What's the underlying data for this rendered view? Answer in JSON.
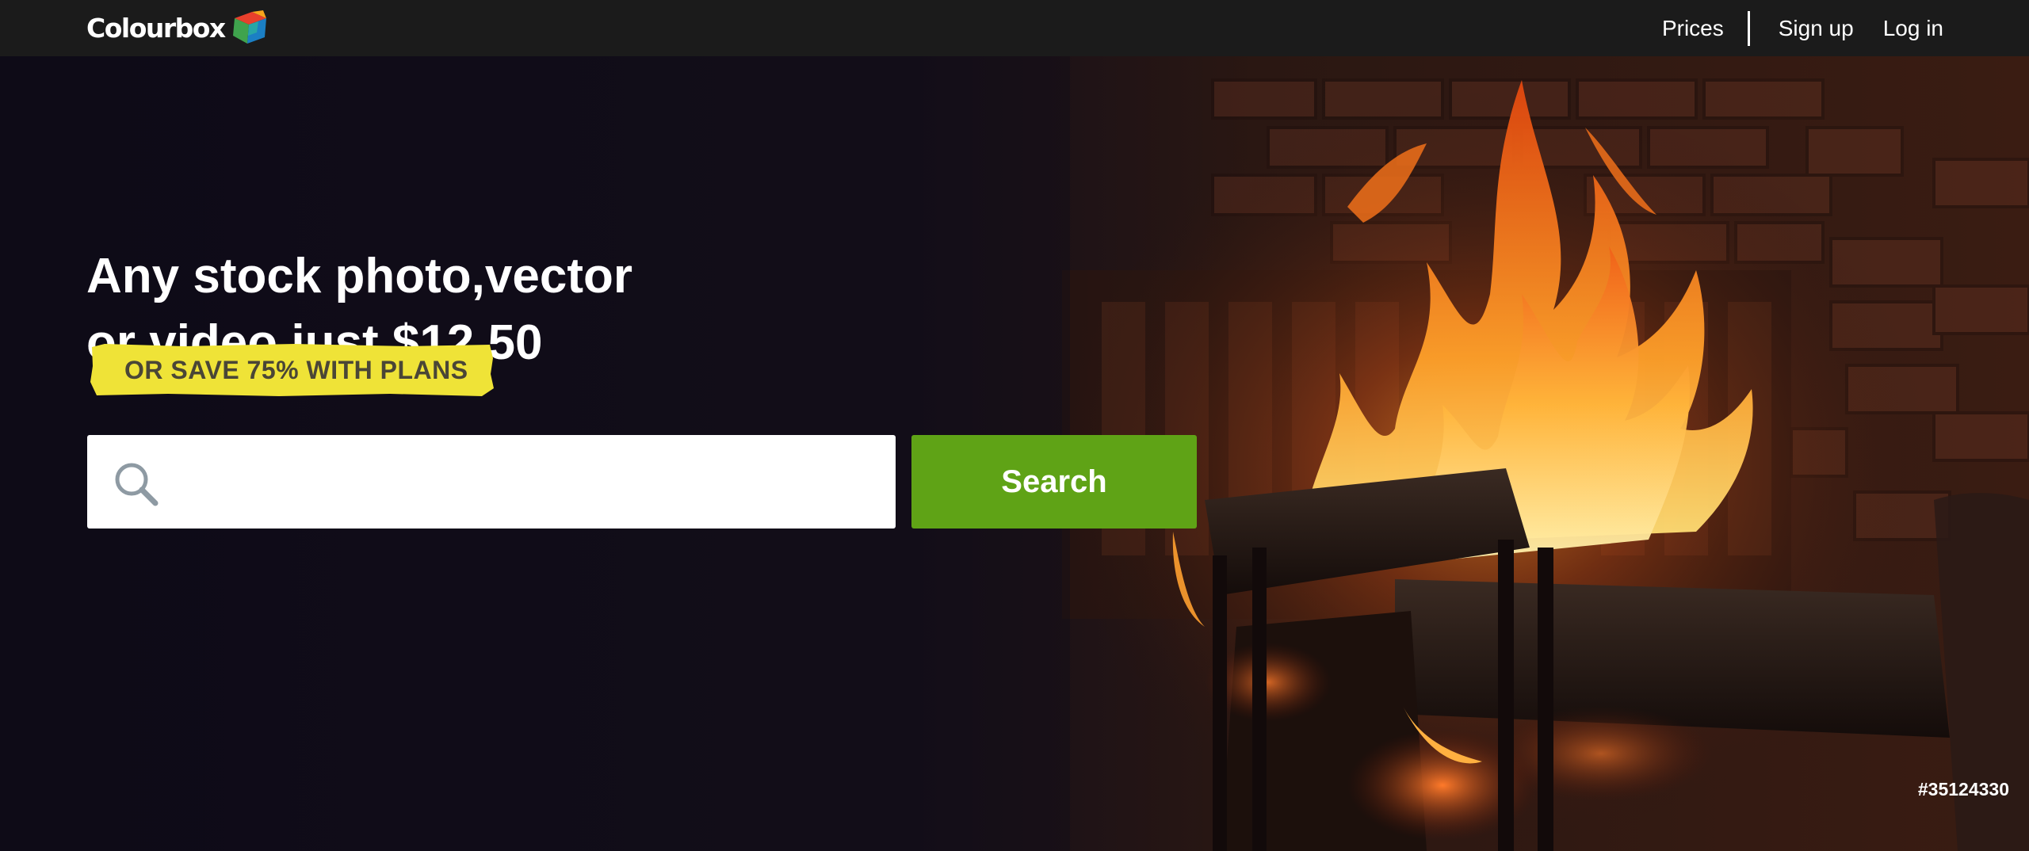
{
  "header": {
    "logo_text": "Colourbox",
    "nav": {
      "prices": "Prices",
      "signup": "Sign up",
      "login": "Log in"
    }
  },
  "hero": {
    "headline_line1": "Any stock photo,vector",
    "headline_line2": "or video just $12.50",
    "promo": "OR SAVE 75% WITH PLANS",
    "search": {
      "placeholder": "",
      "value": "",
      "button_label": "Search"
    },
    "image_id": "#35124330"
  },
  "colors": {
    "topbar": "#1b1b1b",
    "search_button": "#5fa316",
    "promo_highlight": "#efe337"
  },
  "icons": [
    "logo-cube-icon",
    "search-icon"
  ]
}
